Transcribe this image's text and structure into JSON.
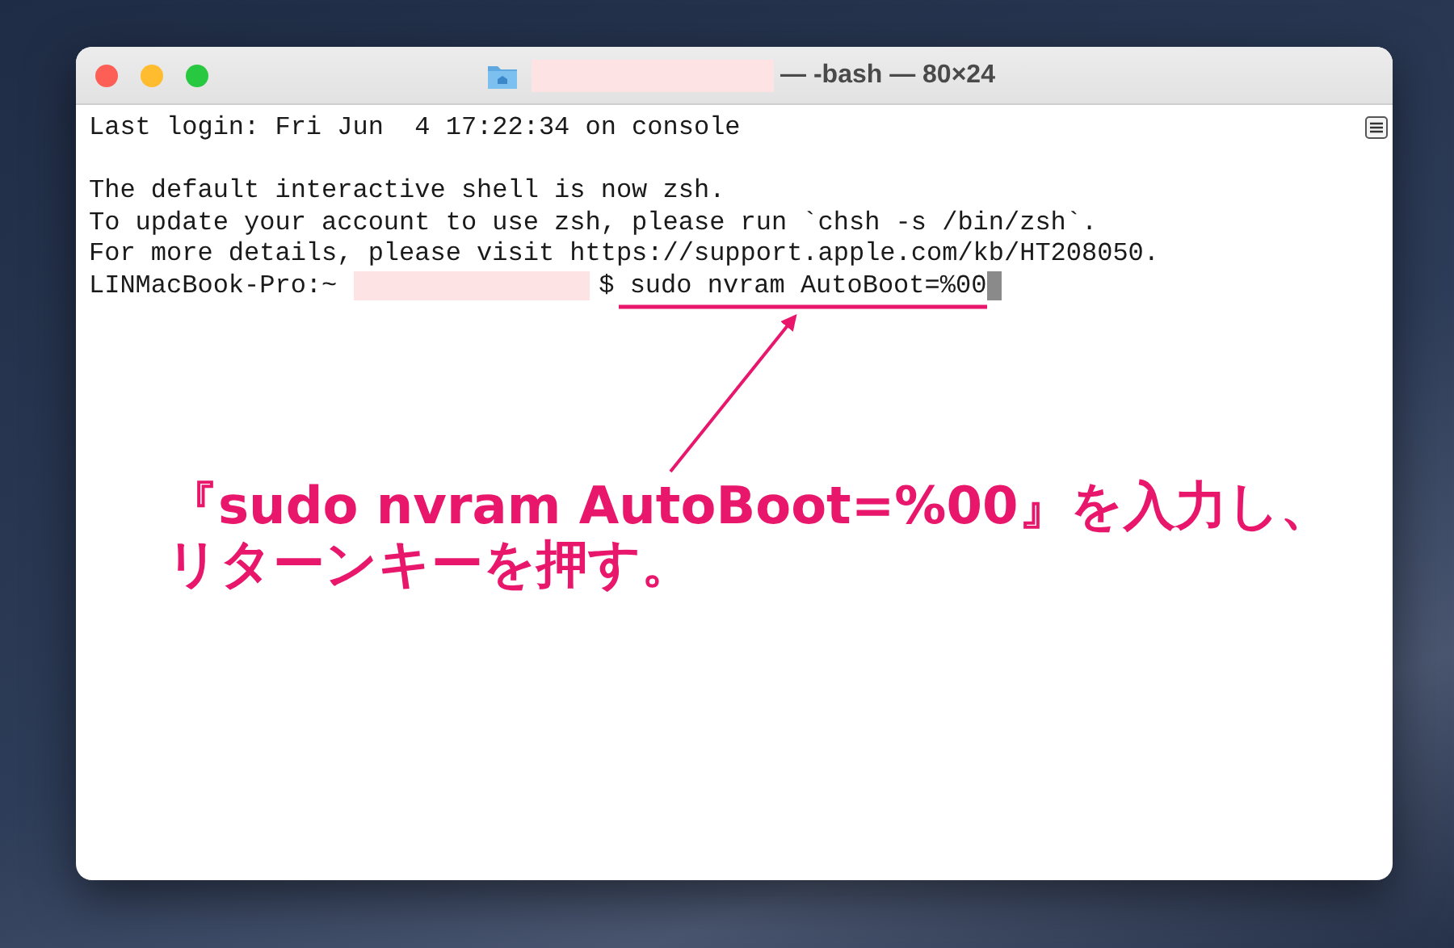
{
  "window": {
    "title": "— -bash — 80×24"
  },
  "terminal": {
    "blocks": [
      [
        "Last login: Fri Jun  4 17:22:34 on console"
      ],
      [
        "The default interactive shell is now zsh.",
        "To update your account to use zsh, please run `chsh -s /bin/zsh`.",
        "For more details, please visit https://support.apple.com/kb/HT208050."
      ]
    ],
    "prompt": {
      "host": "LINMacBook-Pro:~",
      "symbol": "$",
      "command": "sudo nvram AutoBoot=%00"
    }
  },
  "annotation": {
    "lines": [
      "『sudo nvram AutoBoot=%00』を入力し、",
      "リターンキーを押す。"
    ]
  }
}
